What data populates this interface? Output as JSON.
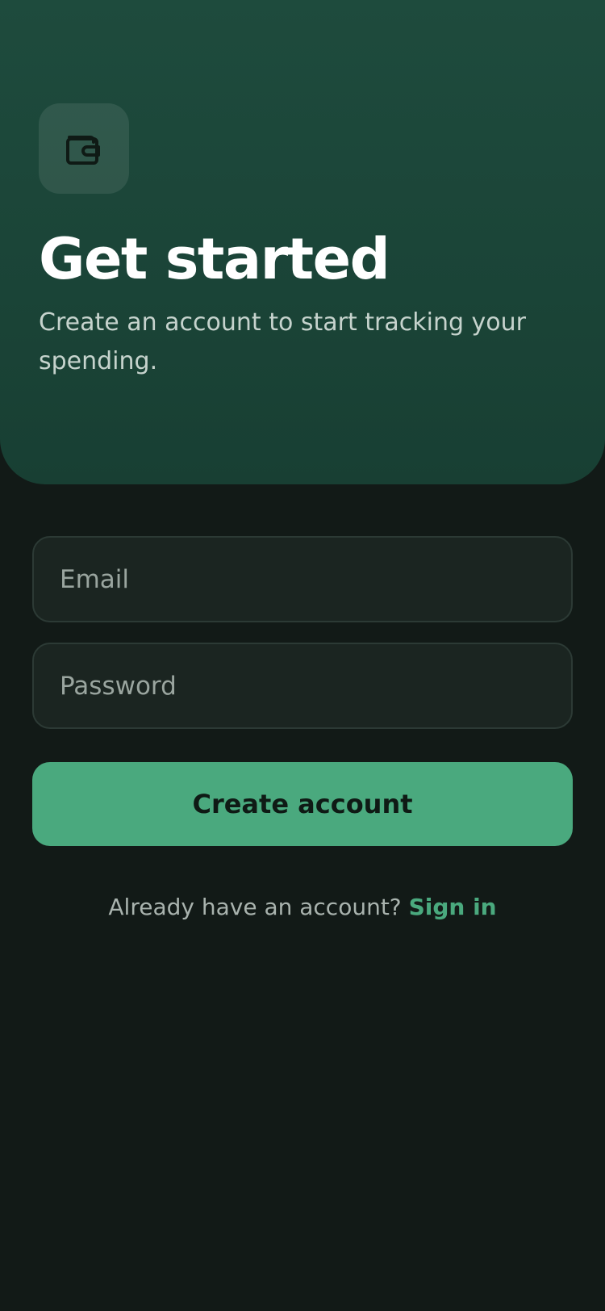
{
  "hero": {
    "icon": "wallet-icon",
    "title": "Get started",
    "subtitle": "Create an account to start tracking your spending."
  },
  "form": {
    "email": {
      "placeholder": "Email",
      "value": ""
    },
    "password": {
      "placeholder": "Password",
      "value": ""
    },
    "submit_label": "Create account"
  },
  "footer": {
    "prompt": "Already have an account?",
    "link_label": "Sign in"
  },
  "colors": {
    "background": "#121a17",
    "hero": "#1e4b3d",
    "accent": "#4aa97e",
    "field": "#1b2521"
  }
}
